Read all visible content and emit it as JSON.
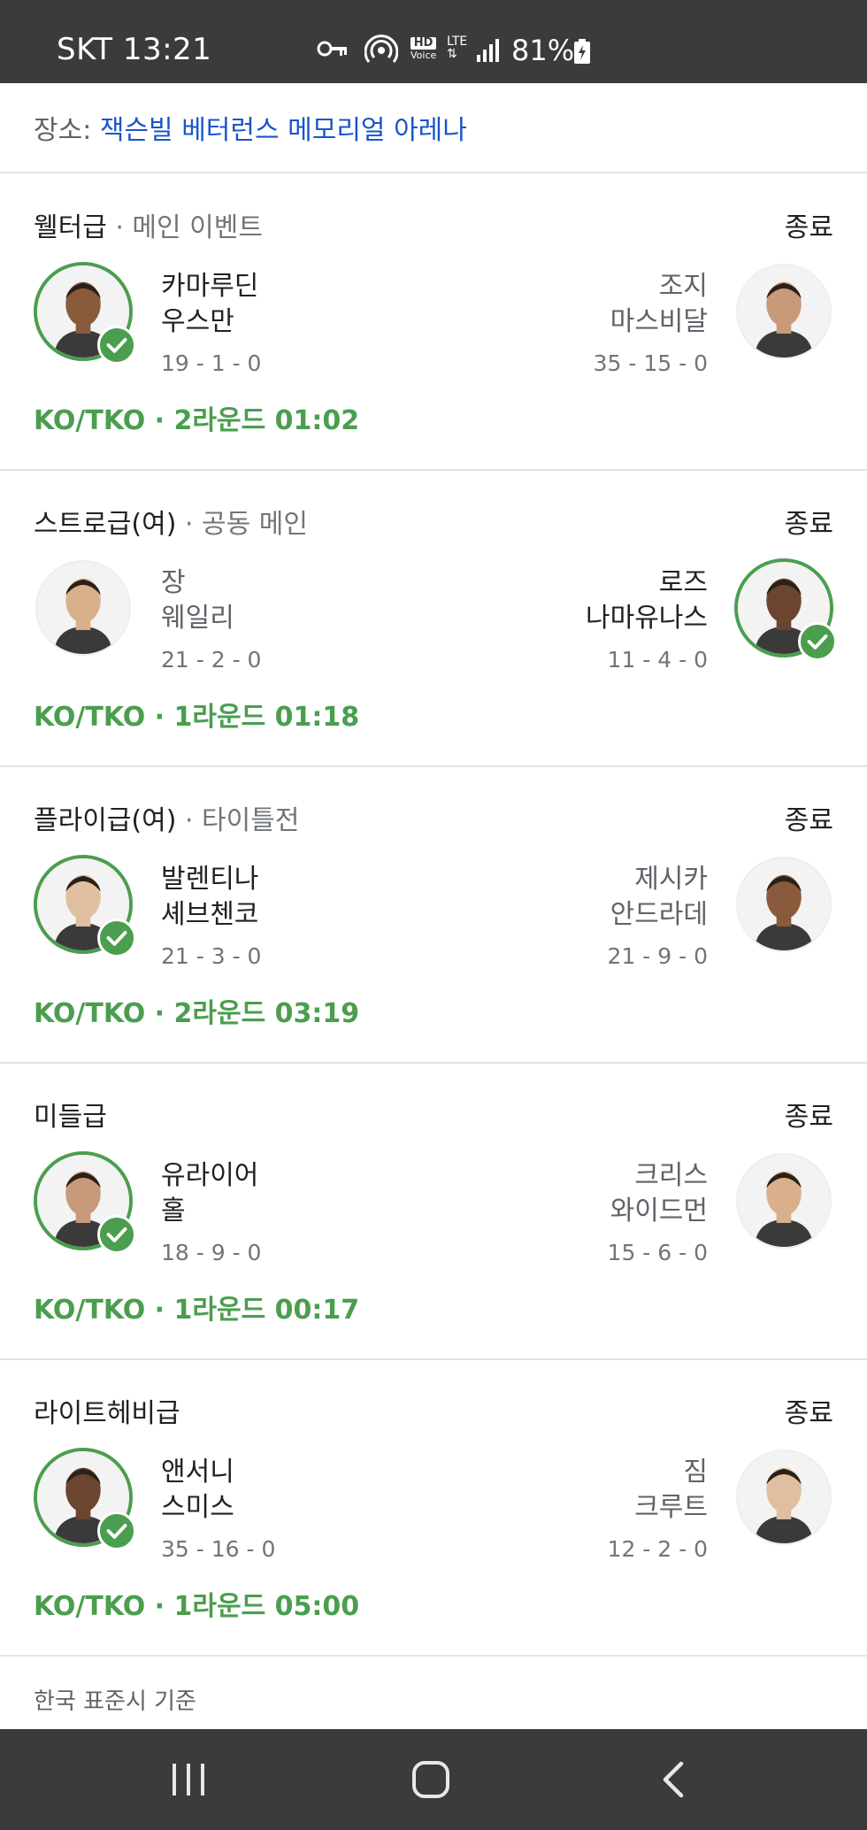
{
  "status_bar": {
    "carrier_time": "SKT 13:21",
    "hd_voice_top": "HD",
    "hd_voice_bottom": "Voice",
    "lte_label": "LTE",
    "battery_percent": "81%",
    "icons": [
      "vpn-key-icon",
      "hotspot-icon",
      "hd-voice-icon",
      "lte-icon",
      "signal-icon",
      "battery-charging-icon"
    ]
  },
  "venue": {
    "label": "장소:",
    "name": "잭슨빌 베터런스 메모리얼 아레나"
  },
  "fights": [
    {
      "weight_class": "웰터급",
      "subtitle": "메인 이벤트",
      "status": "종료",
      "left": {
        "name_line1": "카마루딘",
        "name_line2": "우스만",
        "record": "19 - 1 - 0",
        "winner": true
      },
      "right": {
        "name_line1": "조지",
        "name_line2": "마스비달",
        "record": "35 - 15 - 0",
        "winner": false
      },
      "result": "KO/TKO · 2라운드 01:02"
    },
    {
      "weight_class": "스트로급(여)",
      "subtitle": "공동 메인",
      "status": "종료",
      "left": {
        "name_line1": "장",
        "name_line2": "웨일리",
        "record": "21 - 2 - 0",
        "winner": false
      },
      "right": {
        "name_line1": "로즈",
        "name_line2": "나마유나스",
        "record": "11 - 4 - 0",
        "winner": true
      },
      "result": "KO/TKO · 1라운드 01:18"
    },
    {
      "weight_class": "플라이급(여)",
      "subtitle": "타이틀전",
      "status": "종료",
      "left": {
        "name_line1": "발렌티나",
        "name_line2": "셰브첸코",
        "record": "21 - 3 - 0",
        "winner": true
      },
      "right": {
        "name_line1": "제시카",
        "name_line2": "안드라데",
        "record": "21 - 9 - 0",
        "winner": false
      },
      "result": "KO/TKO · 2라운드 03:19"
    },
    {
      "weight_class": "미들급",
      "subtitle": "",
      "status": "종료",
      "left": {
        "name_line1": "유라이어",
        "name_line2": "홀",
        "record": "18 - 9 - 0",
        "winner": true
      },
      "right": {
        "name_line1": "크리스",
        "name_line2": "와이드먼",
        "record": "15 - 6 - 0",
        "winner": false
      },
      "result": "KO/TKO · 1라운드 00:17"
    },
    {
      "weight_class": "라이트헤비급",
      "subtitle": "",
      "status": "종료",
      "left": {
        "name_line1": "앤서니",
        "name_line2": "스미스",
        "record": "35 - 16 - 0",
        "winner": true
      },
      "right": {
        "name_line1": "짐",
        "name_line2": "크루트",
        "record": "12 - 2 - 0",
        "winner": false
      },
      "result": "KO/TKO · 1라운드 05:00"
    }
  ],
  "footnote": "한국 표준시 기준",
  "colors": {
    "win_green": "#4a9e4e",
    "link_blue": "#1a55c9",
    "bar_dark": "#3b3b3d"
  },
  "nav_bar": {
    "icons": [
      "recent-apps-icon",
      "home-icon",
      "back-icon"
    ]
  }
}
